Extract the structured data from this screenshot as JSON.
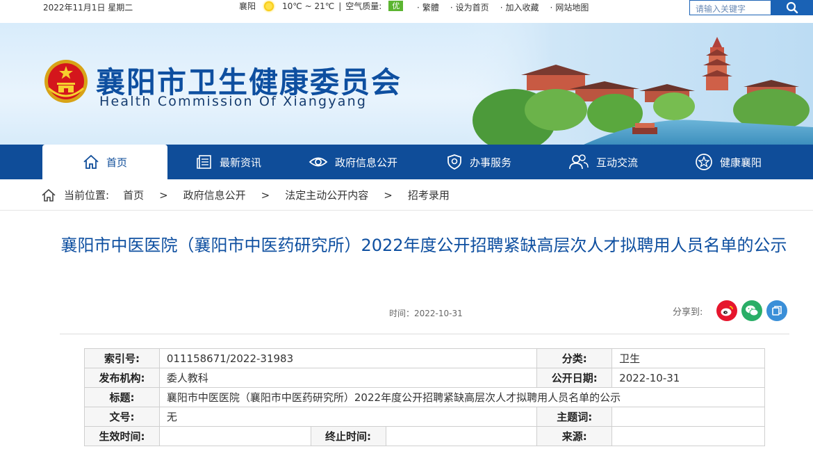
{
  "topbar": {
    "date": "2022年11月1日 星期二",
    "city": "襄阳",
    "temp": "10℃ ~ 21℃",
    "divider": "|",
    "aq_label": "空气质量:",
    "aq_value": "优",
    "links": [
      "繁體",
      "设为首页",
      "加入收藏",
      "网站地图"
    ]
  },
  "search": {
    "placeholder": "请输入关键字"
  },
  "banner": {
    "title_cn": "襄阳市卫生健康委员会",
    "title_en": "Health Commission Of Xiangyang"
  },
  "nav": {
    "items": [
      {
        "label": "首页",
        "icon": "home-icon"
      },
      {
        "label": "最新资讯",
        "icon": "news-icon"
      },
      {
        "label": "政府信息公开",
        "icon": "eye-icon"
      },
      {
        "label": "办事服务",
        "icon": "shield-icon"
      },
      {
        "label": "互动交流",
        "icon": "people-icon"
      },
      {
        "label": "健康襄阳",
        "icon": "star-icon"
      }
    ]
  },
  "breadcrumb": {
    "prefix": "当前位置:",
    "items": [
      "首页",
      "政府信息公开",
      "法定主动公开内容",
      "招考录用"
    ],
    "separator": ">"
  },
  "article": {
    "title": "襄阳市中医医院（襄阳市中医药研究所）2022年度公开招聘紧缺高层次人才拟聘用人员名单的公示",
    "time": "时间：2022-10-31",
    "share_label": "分享到:"
  },
  "info": {
    "index_label": "索引号:",
    "index_value": "011158671/2022-31983",
    "category_label": "分类:",
    "category_value": "卫生",
    "publisher_label": "发布机构:",
    "publisher_value": "委人教科",
    "pubdate_label": "公开日期:",
    "pubdate_value": "2022-10-31",
    "title_label": "标题:",
    "title_value": "襄阳市中医医院（襄阳市中医药研究所）2022年度公开招聘紧缺高层次人才拟聘用人员名单的公示",
    "docno_label": "文号:",
    "docno_value": "无",
    "subject_label": "主题词:",
    "subject_value": "",
    "effective_label": "生效时间:",
    "effective_value": "",
    "expiry_label": "终止时间:",
    "expiry_value": "",
    "source_label": "来源:",
    "source_value": ""
  },
  "colors": {
    "brand_blue": "#0f4d99",
    "title_blue": "#0e4fa0",
    "weibo": "#e6162d",
    "wechat": "#2aae67",
    "other": "#3a8fd8"
  }
}
